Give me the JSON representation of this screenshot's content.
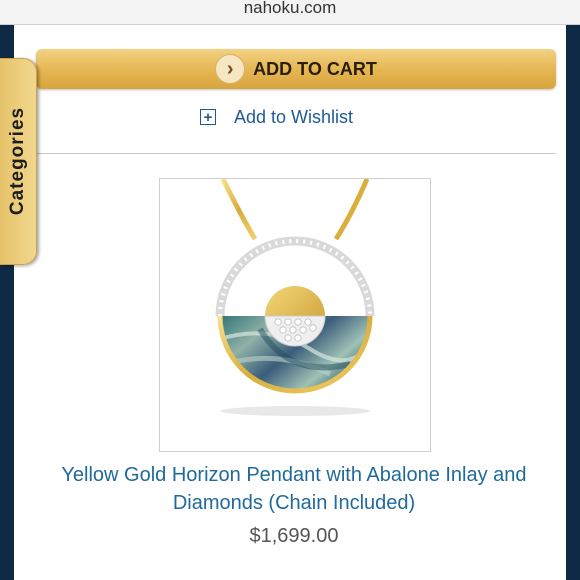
{
  "browser": {
    "url": "nahoku.com"
  },
  "sidebar_tab": {
    "label": "Categories"
  },
  "actions": {
    "add_to_cart_label": "ADD TO CART",
    "chevron_glyph": "›",
    "wishlist_icon_glyph": "+",
    "wishlist_label": "Add to Wishlist"
  },
  "product": {
    "image_subject": "yellow-gold-horizon-pendant",
    "title": "Yellow Gold Horizon Pendant with Abalone Inlay and Diamonds (Chain Included)",
    "price": "$1,699.00"
  },
  "colors": {
    "nav_dark": "#0f2a44",
    "button_gold": "#e4b551",
    "link_blue": "#1f5a96"
  }
}
